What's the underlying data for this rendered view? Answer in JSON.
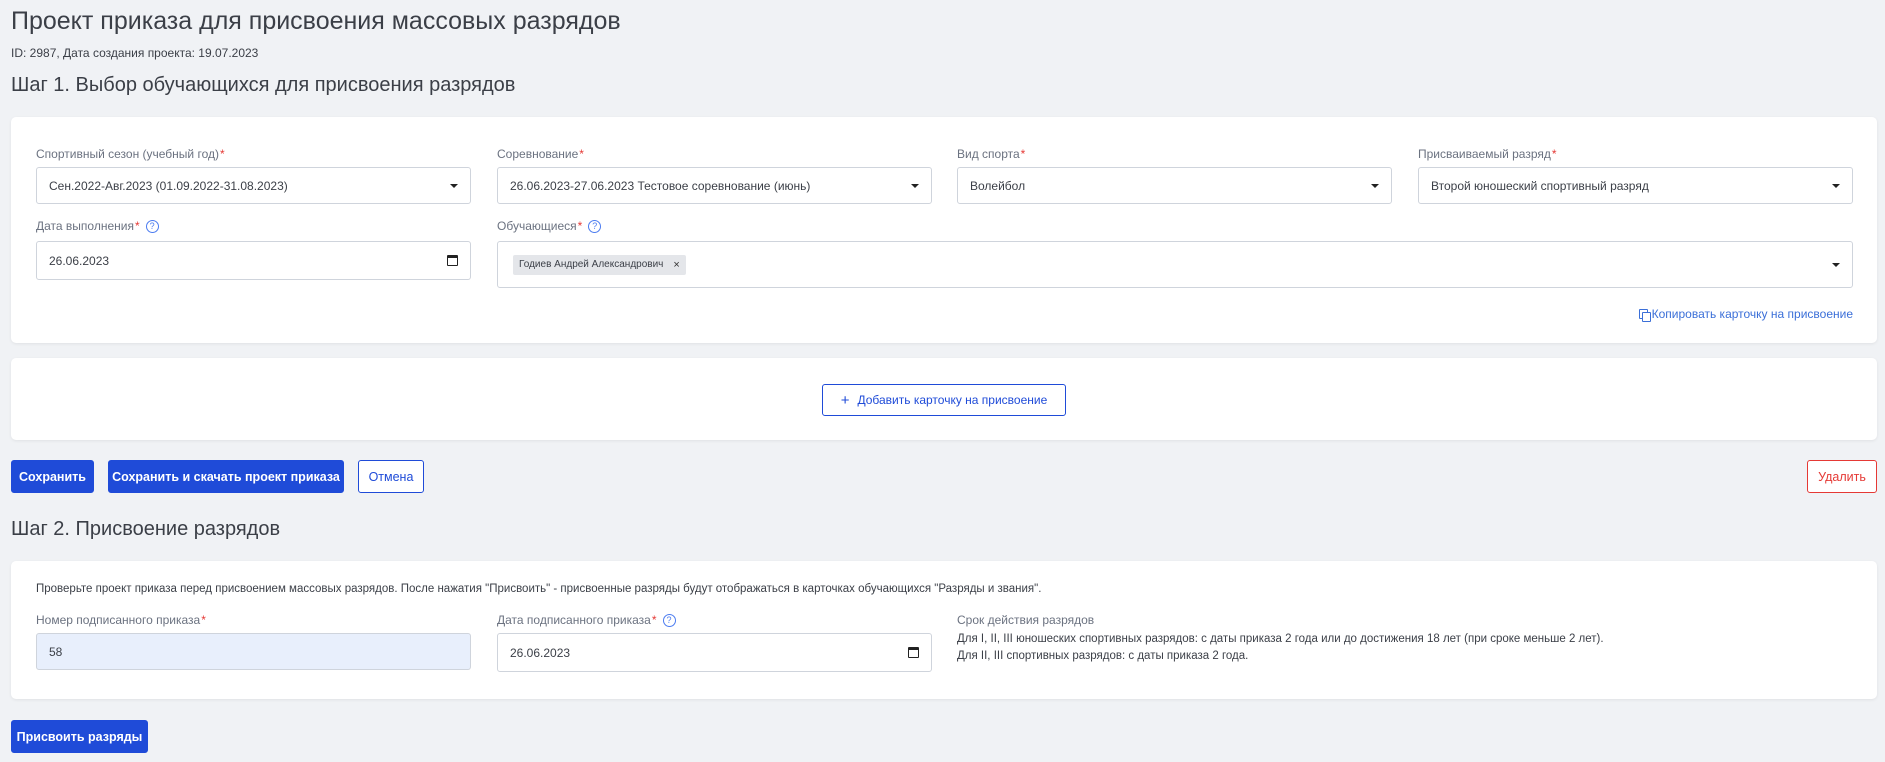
{
  "header": {
    "title": "Проект приказа для присвоения массовых разрядов",
    "meta": "ID: 2987, Дата создания проекта: 19.07.2023"
  },
  "step1": {
    "title": "Шаг 1. Выбор обучающихся для присвоения разрядов",
    "season": {
      "label": "Спортивный сезон (учебный год)",
      "value": "Сен.2022-Авг.2023 (01.09.2022-31.08.2023)"
    },
    "competition": {
      "label": "Соревнование",
      "value": "26.06.2023-27.06.2023 Тестовое соревнование (июнь)"
    },
    "sport": {
      "label": "Вид спорта",
      "value": "Волейбол"
    },
    "rank": {
      "label": "Присваиваемый разряд",
      "value": "Второй юношеский спортивный разряд"
    },
    "date": {
      "label": "Дата выполнения",
      "value": "26.06.2023"
    },
    "students": {
      "label": "Обучающиеся",
      "chips": [
        "Годиев Андрей Александрович"
      ]
    },
    "copy_link": "Копировать карточку на присвоение",
    "add_card": "Добавить карточку на присвоение",
    "required_mark": "*",
    "help_mark": "?"
  },
  "actions": {
    "save": "Сохранить",
    "save_download": "Сохранить и скачать проект приказа",
    "cancel": "Отмена",
    "delete": "Удалить"
  },
  "step2": {
    "title": "Шаг 2. Присвоение разрядов",
    "notice": "Проверьте проект приказа перед присвоением массовых разрядов. После нажатия \"Присвоить\" - присвоенные разряды будут отображаться в карточках обучающихся \"Разряды и звания\".",
    "order_number": {
      "label": "Номер подписанного приказа",
      "value": "58"
    },
    "order_date": {
      "label": "Дата подписанного приказа",
      "value": "26.06.2023"
    },
    "validity": {
      "title": "Срок действия разрядов",
      "line1": "Для I, II, III юношеских спортивных разрядов: с даты приказа 2 года или до достижения 18 лет (при сроке меньше 2 лет).",
      "line2": "Для II, III спортивных разрядов: с даты приказа 2 года."
    },
    "assign_button": "Присвоить разряды"
  }
}
